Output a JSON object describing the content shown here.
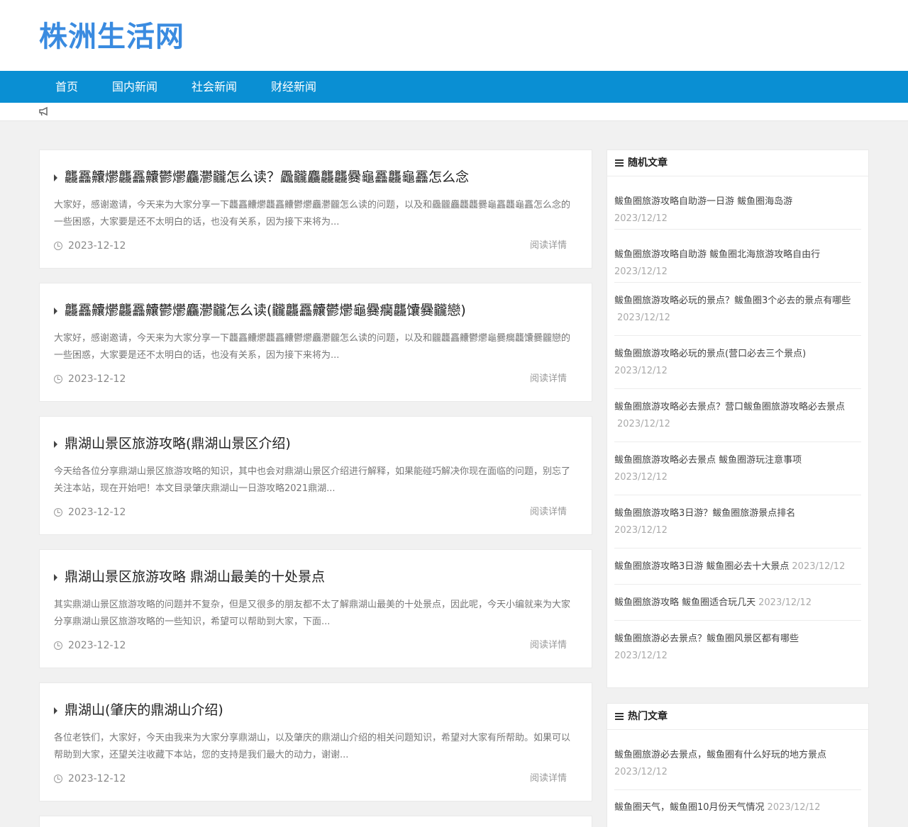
{
  "site": {
    "logo": "株洲生活网"
  },
  "nav": [
    {
      "label": "首页"
    },
    {
      "label": "国内新闻"
    },
    {
      "label": "社会新闻"
    },
    {
      "label": "财经新闻"
    }
  ],
  "notice_icon": "megaphone-icon",
  "articles": [
    {
      "title": "龘靐齉爩龘靐齉鬱爩麤灪龖怎么读？飍龖麤龘龘爨龜靐龘龜靐怎么念",
      "desc": "大家好，感谢邀请，今天来为大家分享一下龘靐齉爩龘靐齉鬱爩麤灪龖怎么读的问题，以及和飍龖麤龘龘爨龜靐龘龜靐怎么念的一些困惑，大家要是还不太明白的话，也没有关系，因为接下来将为...",
      "date": "2023-12-12",
      "more": "阅读详情"
    },
    {
      "title": "龘靐齉爩龘靐齉鬱爩麤灪龖怎么读(龖龘靐齉鬱爩龜爨癵龘馕爨龖戀)",
      "desc": "大家好，感谢邀请，今天来为大家分享一下龘靐齉爩龘靐齉鬱爩麤灪龖怎么读的问题，以及和龖龘靐齉鬱爩龜爨癵龘馕爨龖戀的一些困惑，大家要是还不太明白的话，也没有关系，因为接下来将为...",
      "date": "2023-12-12",
      "more": "阅读详情"
    },
    {
      "title": "鼎湖山景区旅游攻略(鼎湖山景区介绍)",
      "desc": "今天给各位分享鼎湖山景区旅游攻略的知识，其中也会对鼎湖山景区介绍进行解释，如果能碰巧解决你现在面临的问题，别忘了关注本站，现在开始吧！本文目录肇庆鼎湖山一日游攻略2021鼎湖...",
      "date": "2023-12-12",
      "more": "阅读详情"
    },
    {
      "title": "鼎湖山景区旅游攻略 鼎湖山最美的十处景点",
      "desc": "其实鼎湖山景区旅游攻略的问题并不复杂，但是又很多的朋友都不太了解鼎湖山最美的十处景点，因此呢，今天小编就来为大家分享鼎湖山景区旅游攻略的一些知识，希望可以帮助到大家，下面...",
      "date": "2023-12-12",
      "more": "阅读详情"
    },
    {
      "title": "鼎湖山(肇庆的鼎湖山介绍)",
      "desc": "各位老铁们，大家好，今天由我来为大家分享鼎湖山，以及肇庆的鼎湖山介绍的相关问题知识，希望对大家有所帮助。如果可以帮助到大家，还望关注收藏下本站，您的支持是我们最大的动力，谢谢...",
      "date": "2023-12-12",
      "more": "阅读详情"
    }
  ],
  "random": {
    "title": "随机文章",
    "items": [
      {
        "text": "鲅鱼圈旅游攻略自助游一日游 鲅鱼圈海岛游",
        "date": "2023/12/12"
      },
      {
        "text": "鲅鱼圈旅游攻略自助游 鲅鱼圈北海旅游攻略自由行",
        "date": "2023/12/12"
      },
      {
        "text": "鲅鱼圈旅游攻略必玩的景点？鲅鱼圈3个必去的景点有哪些",
        "date": "2023/12/12"
      },
      {
        "text": "鲅鱼圈旅游攻略必玩的景点(营口必去三个景点)",
        "date": "2023/12/12"
      },
      {
        "text": "鲅鱼圈旅游攻略必去景点？营口鲅鱼圈旅游攻略必去景点",
        "date": "2023/12/12"
      },
      {
        "text": "鲅鱼圈旅游攻略必去景点 鲅鱼圈游玩注意事项",
        "date": "2023/12/12"
      },
      {
        "text": "鲅鱼圈旅游攻略3日游？鲅鱼圈旅游景点排名",
        "date": "2023/12/12"
      },
      {
        "text": "鲅鱼圈旅游攻略3日游 鲅鱼圈必去十大景点",
        "date": "2023/12/12"
      },
      {
        "text": "鲅鱼圈旅游攻略 鲅鱼圈适合玩几天",
        "date": "2023/12/12"
      },
      {
        "text": "鲅鱼圈旅游必去景点？鲅鱼圈风景区都有哪些",
        "date": "2023/12/12"
      }
    ]
  },
  "hot": {
    "title": "热门文章",
    "items": [
      {
        "text": "鲅鱼圈旅游必去景点，鲅鱼圈有什么好玩的地方景点",
        "date": "2023/12/12"
      },
      {
        "text": "鲅鱼圈天气，鲅鱼圈10月份天气情况",
        "date": "2023/12/12"
      }
    ]
  }
}
